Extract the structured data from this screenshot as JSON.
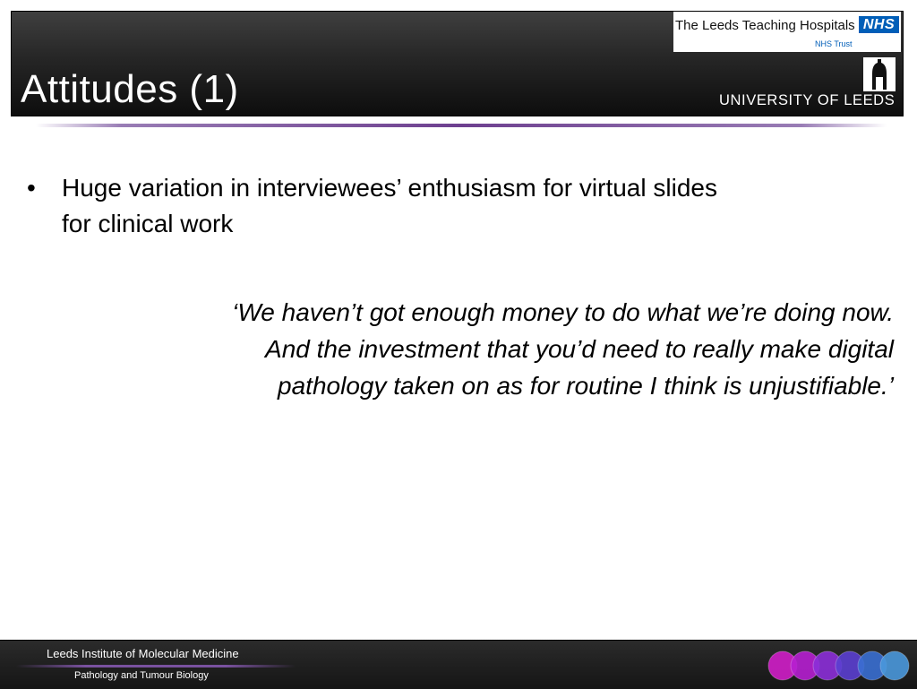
{
  "header": {
    "title": "Attitudes (1)",
    "nhs_logo": {
      "name": "The Leeds Teaching Hospitals",
      "mark": "NHS",
      "trust": "NHS Trust"
    },
    "university_name": "UNIVERSITY OF LEEDS"
  },
  "content": {
    "bullets": [
      {
        "marker": "•",
        "lines": [
          "Huge variation in interviewees’ enthusiasm for virtual slides",
          "for clinical work"
        ]
      }
    ],
    "quote_lines": [
      "‘We haven’t got enough money to do what we’re doing now.",
      "And the investment that you’d need to really make digital",
      "pathology taken on as for routine I think is unjustifiable.’"
    ]
  },
  "footer": {
    "institute": "Leeds Institute of Molecular Medicine",
    "department": "Pathology and Tumour Biology"
  },
  "colors": {
    "header_dark": "#0d0d0d",
    "divider_purple": "#6d3f8f",
    "nhs_blue": "#005eb8",
    "footer_circles": [
      "#d01ec8",
      "#b61fd0",
      "#8c2fd8",
      "#5b3fd0",
      "#3a6fd2",
      "#4a98dc"
    ]
  },
  "icons": {
    "crest": "university-crest-icon",
    "circles": "tissue-circles-icon"
  }
}
